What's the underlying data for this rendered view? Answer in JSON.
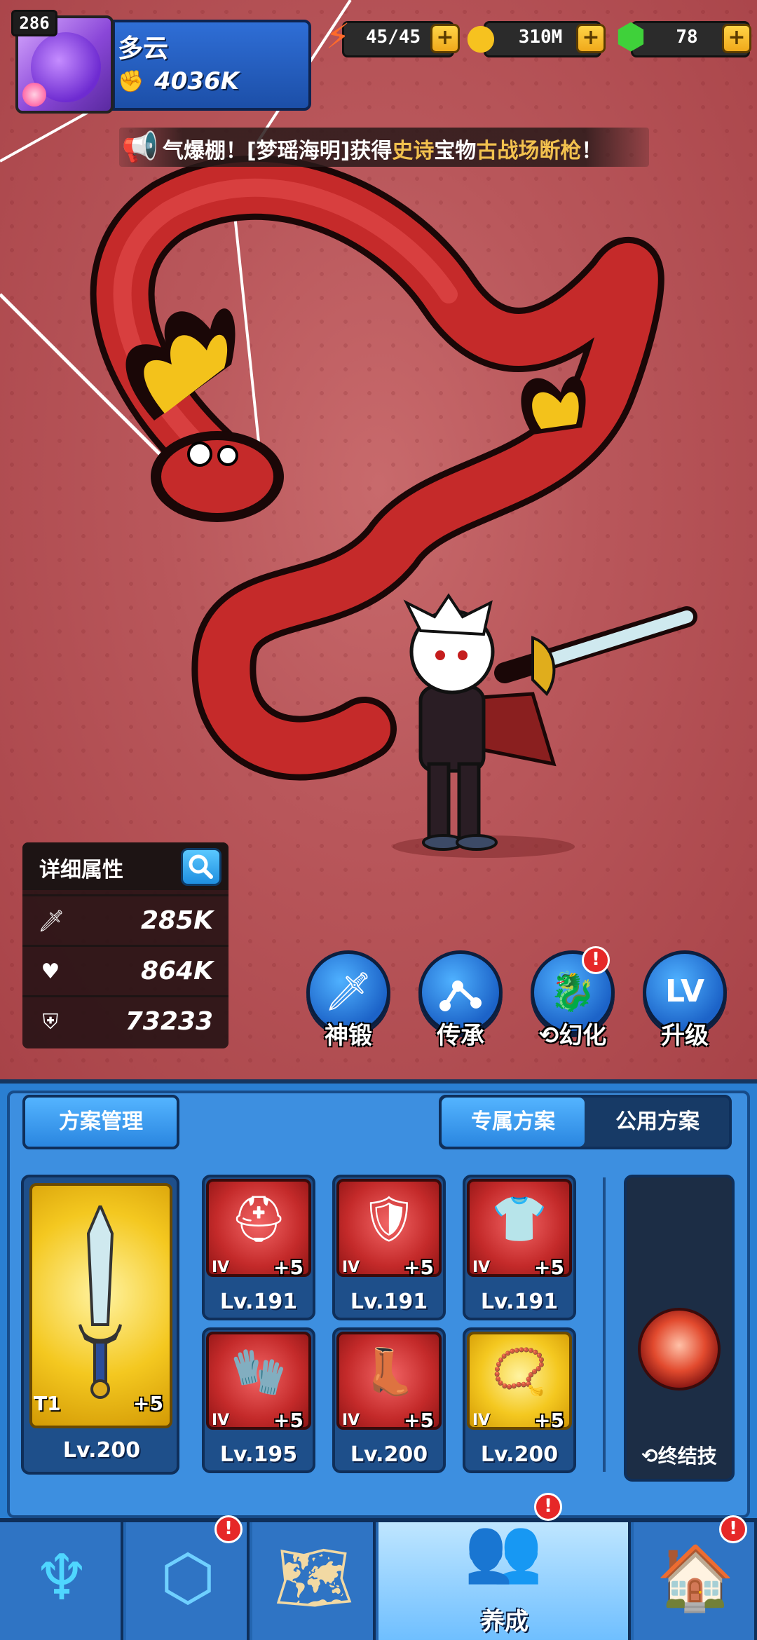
{
  "player": {
    "level": "286",
    "name": "多云",
    "power": "4036K"
  },
  "resources": {
    "stamina": "45/45",
    "gold": "310M",
    "gems": "78"
  },
  "notice": {
    "prefix": "气爆棚！[梦瑶海明]获得",
    "rarity": "史诗",
    "middle": "宝物",
    "item": "古战场断枪",
    "suffix": "！"
  },
  "stats": {
    "title": "详细属性",
    "attack": "285K",
    "health": "864K",
    "defense": "73233"
  },
  "actions": [
    {
      "label": "神锻",
      "icon": "sword-icon"
    },
    {
      "label": "传承",
      "icon": "link-icon"
    },
    {
      "label": "⟲幻化",
      "icon": "beast-icon"
    },
    {
      "label": "升级",
      "icon": "level-up-icon",
      "glyph": "LV"
    }
  ],
  "equipment": {
    "plan_manage": "方案管理",
    "tab_exclusive": "专属方案",
    "tab_public": "公用方案",
    "weapon": {
      "tier": "T1",
      "plus": "+5",
      "level": "Lv.200"
    },
    "slots": [
      {
        "tag": "IV",
        "plus": "+5",
        "level": "Lv.191",
        "item": "helmet-icon"
      },
      {
        "tag": "IV",
        "plus": "+5",
        "level": "Lv.191",
        "item": "armor-icon"
      },
      {
        "tag": "IV",
        "plus": "+5",
        "level": "Lv.191",
        "item": "chest-icon"
      },
      {
        "tag": "IV",
        "plus": "+5",
        "level": "Lv.195",
        "item": "gauntlet-icon"
      },
      {
        "tag": "IV",
        "plus": "+5",
        "level": "Lv.200",
        "item": "boots-icon"
      },
      {
        "tag": "IV",
        "plus": "+5",
        "level": "Lv.200",
        "item": "necklace-icon"
      }
    ],
    "skill_label": "⟲终结技"
  },
  "nav": {
    "active_label": "养成"
  },
  "colors": {
    "accent_blue": "#2a86e0",
    "gold": "#f2c14e",
    "alert_red": "#e62828"
  }
}
